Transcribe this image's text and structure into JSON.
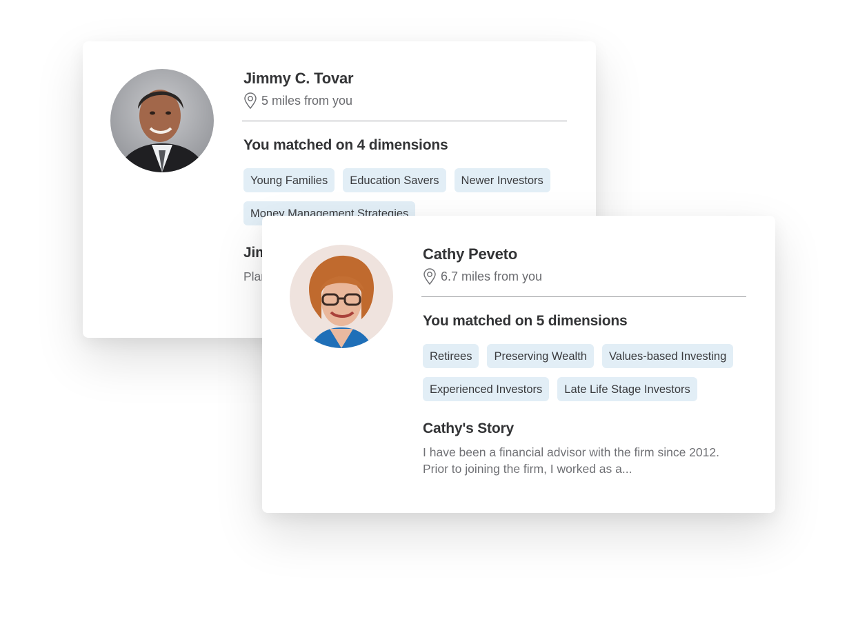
{
  "advisors": [
    {
      "name": "Jimmy C. Tovar",
      "distance": "5 miles from you",
      "matched_heading": "You matched on 4 dimensions",
      "tags": [
        "Young Families",
        "Education Savers",
        "Newer Investors",
        "Money Management Strategies"
      ],
      "story_title": "Jimmy's Story",
      "story_text": "Planning for your future and providing the best solutions..."
    },
    {
      "name": "Cathy Peveto",
      "distance": "6.7 miles from you",
      "matched_heading": "You matched on 5 dimensions",
      "tags": [
        "Retirees",
        "Preserving Wealth",
        "Values-based Investing",
        "Experienced Investors",
        "Late Life Stage Investors"
      ],
      "story_title": "Cathy's Story",
      "story_text": "I have been a financial advisor with the firm since 2012. Prior to joining the firm, I worked as a..."
    }
  ],
  "icons": {
    "location": "map-pin-icon"
  },
  "colors": {
    "tag_bg": "#e2eef6",
    "heading": "#333436",
    "muted": "#6b6c70"
  }
}
